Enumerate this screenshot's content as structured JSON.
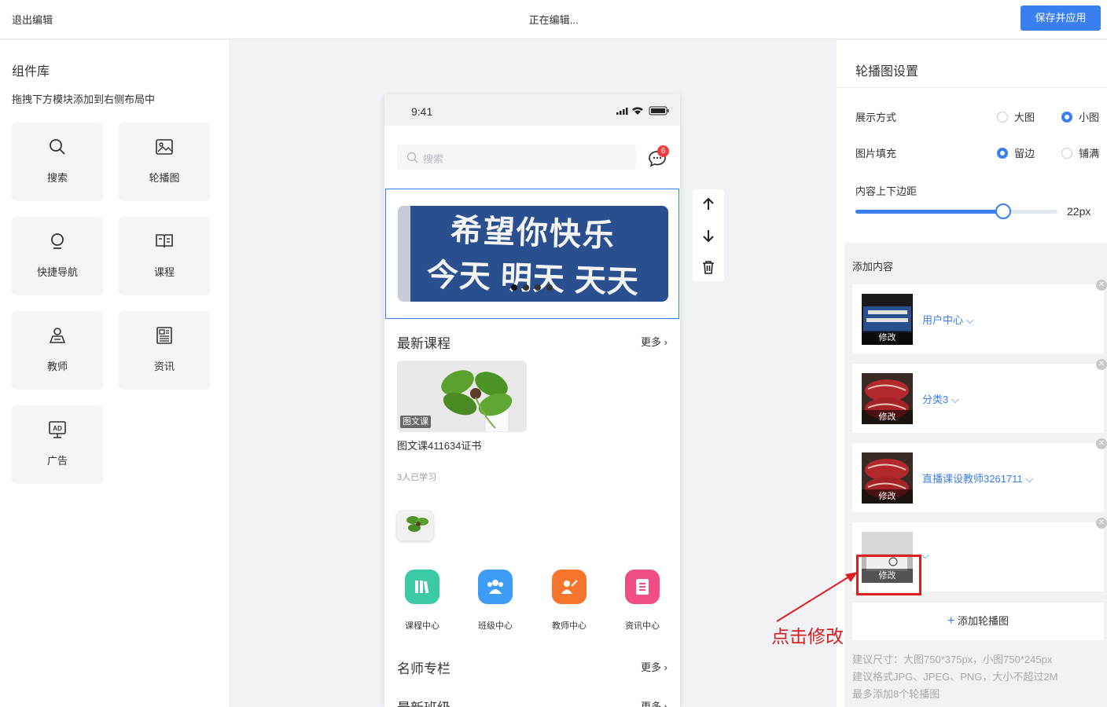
{
  "topbar": {
    "exit_label": "退出编辑",
    "status": "正在编辑...",
    "save_label": "保存并应用"
  },
  "library": {
    "title": "组件库",
    "subtitle": "拖拽下方模块添加到右侧布局中",
    "items": [
      {
        "label": "搜索",
        "icon": "search-icon"
      },
      {
        "label": "轮播图",
        "icon": "image-icon"
      },
      {
        "label": "快捷导航",
        "icon": "bulb-icon"
      },
      {
        "label": "课程",
        "icon": "book-icon"
      },
      {
        "label": "教师",
        "icon": "teacher-icon"
      },
      {
        "label": "资讯",
        "icon": "news-icon"
      },
      {
        "label": "广告",
        "icon": "ad-icon"
      }
    ]
  },
  "phone": {
    "time": "9:41",
    "search_placeholder": "搜索",
    "msg_badge": "6",
    "banner_text_1": "希望你快乐",
    "banner_text_2": "今天 明天 天天",
    "latest_course": {
      "title": "最新课程",
      "more": "更多"
    },
    "course": {
      "tag": "图文课",
      "name": "图文课411634证书",
      "students": "3人已学习"
    },
    "nav": [
      {
        "label": "课程中心",
        "color": "#3cc9a5"
      },
      {
        "label": "班级中心",
        "color": "#3d9cf5"
      },
      {
        "label": "教师中心",
        "color": "#f5752d"
      },
      {
        "label": "资讯中心",
        "color": "#f04d82"
      }
    ],
    "famous": {
      "title": "名师专栏",
      "more": "更多"
    },
    "latest_class": {
      "title": "最新班级",
      "more": "更多"
    }
  },
  "settings": {
    "title": "轮播图设置",
    "display": {
      "label": "展示方式",
      "opt1": "大图",
      "opt2": "小图",
      "selected": "小图"
    },
    "fill": {
      "label": "图片填充",
      "opt1": "留边",
      "opt2": "铺满",
      "selected": "留边"
    },
    "padding": {
      "label": "内容上下边距",
      "value": "22px",
      "fraction": 0.73
    },
    "add_content": "添加内容",
    "items": [
      {
        "link": "用户中心",
        "modify": "修改",
        "thumb": "banner"
      },
      {
        "link": "分类3",
        "modify": "修改",
        "thumb": "meat"
      },
      {
        "link": "直播课设教师3261711",
        "modify": "修改",
        "thumb": "meat"
      },
      {
        "link": "",
        "modify": "修改",
        "thumb": "photo"
      }
    ],
    "add_banner": "添加轮播图",
    "tips": [
      "建议尺寸：大图750*375px，小图750*245px",
      "建议格式JPG、JPEG、PNG，大小不超过2M",
      "最多添加8个轮播图"
    ]
  },
  "annotation": "点击修改"
}
